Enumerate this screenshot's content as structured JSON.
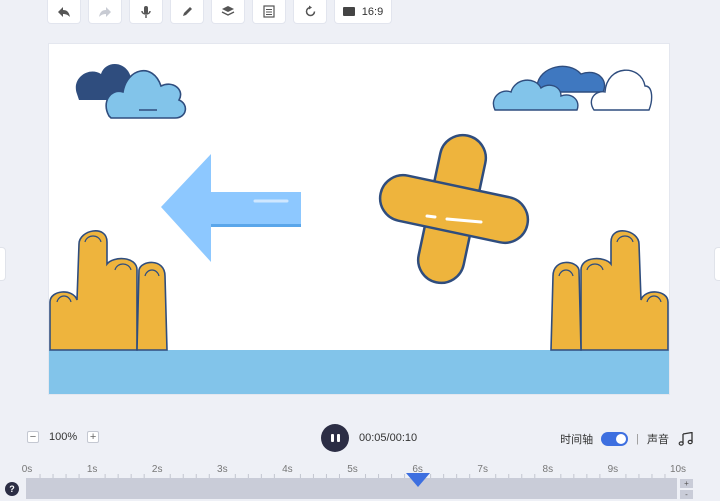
{
  "toolbar": {
    "items": [
      {
        "icon": "undo-icon"
      },
      {
        "icon": "redo-icon"
      },
      {
        "icon": "microphone-icon"
      },
      {
        "icon": "pen-icon"
      },
      {
        "icon": "layers-icon"
      },
      {
        "icon": "notes-icon"
      },
      {
        "icon": "rotate-icon"
      }
    ],
    "ratio_icon": "screen-icon",
    "ratio_label": "16:9"
  },
  "controls": {
    "zoom_minus": "−",
    "zoom_value": "100%",
    "zoom_plus": "+",
    "current_time": "00:05",
    "total_time": "00:10",
    "time_display": "00:05/00:10",
    "timeline_label": "时间轴",
    "timeline_on": true,
    "separator": "|",
    "sound_label": "声音",
    "music_icon": "music-note-icon"
  },
  "timeline": {
    "ticks": [
      "0s",
      "1s",
      "2s",
      "3s",
      "4s",
      "5s",
      "6s",
      "7s",
      "8s",
      "9s",
      "10s"
    ],
    "playhead_seconds": 6,
    "zoom_in": "+",
    "zoom_out": "-",
    "help": "?"
  },
  "colors": {
    "accent": "#3d6fe0",
    "hand": "#eeb43d",
    "outline": "#2f4d7e",
    "sky_ground": "#82c4ea",
    "arrow": "#8dc8ff"
  }
}
